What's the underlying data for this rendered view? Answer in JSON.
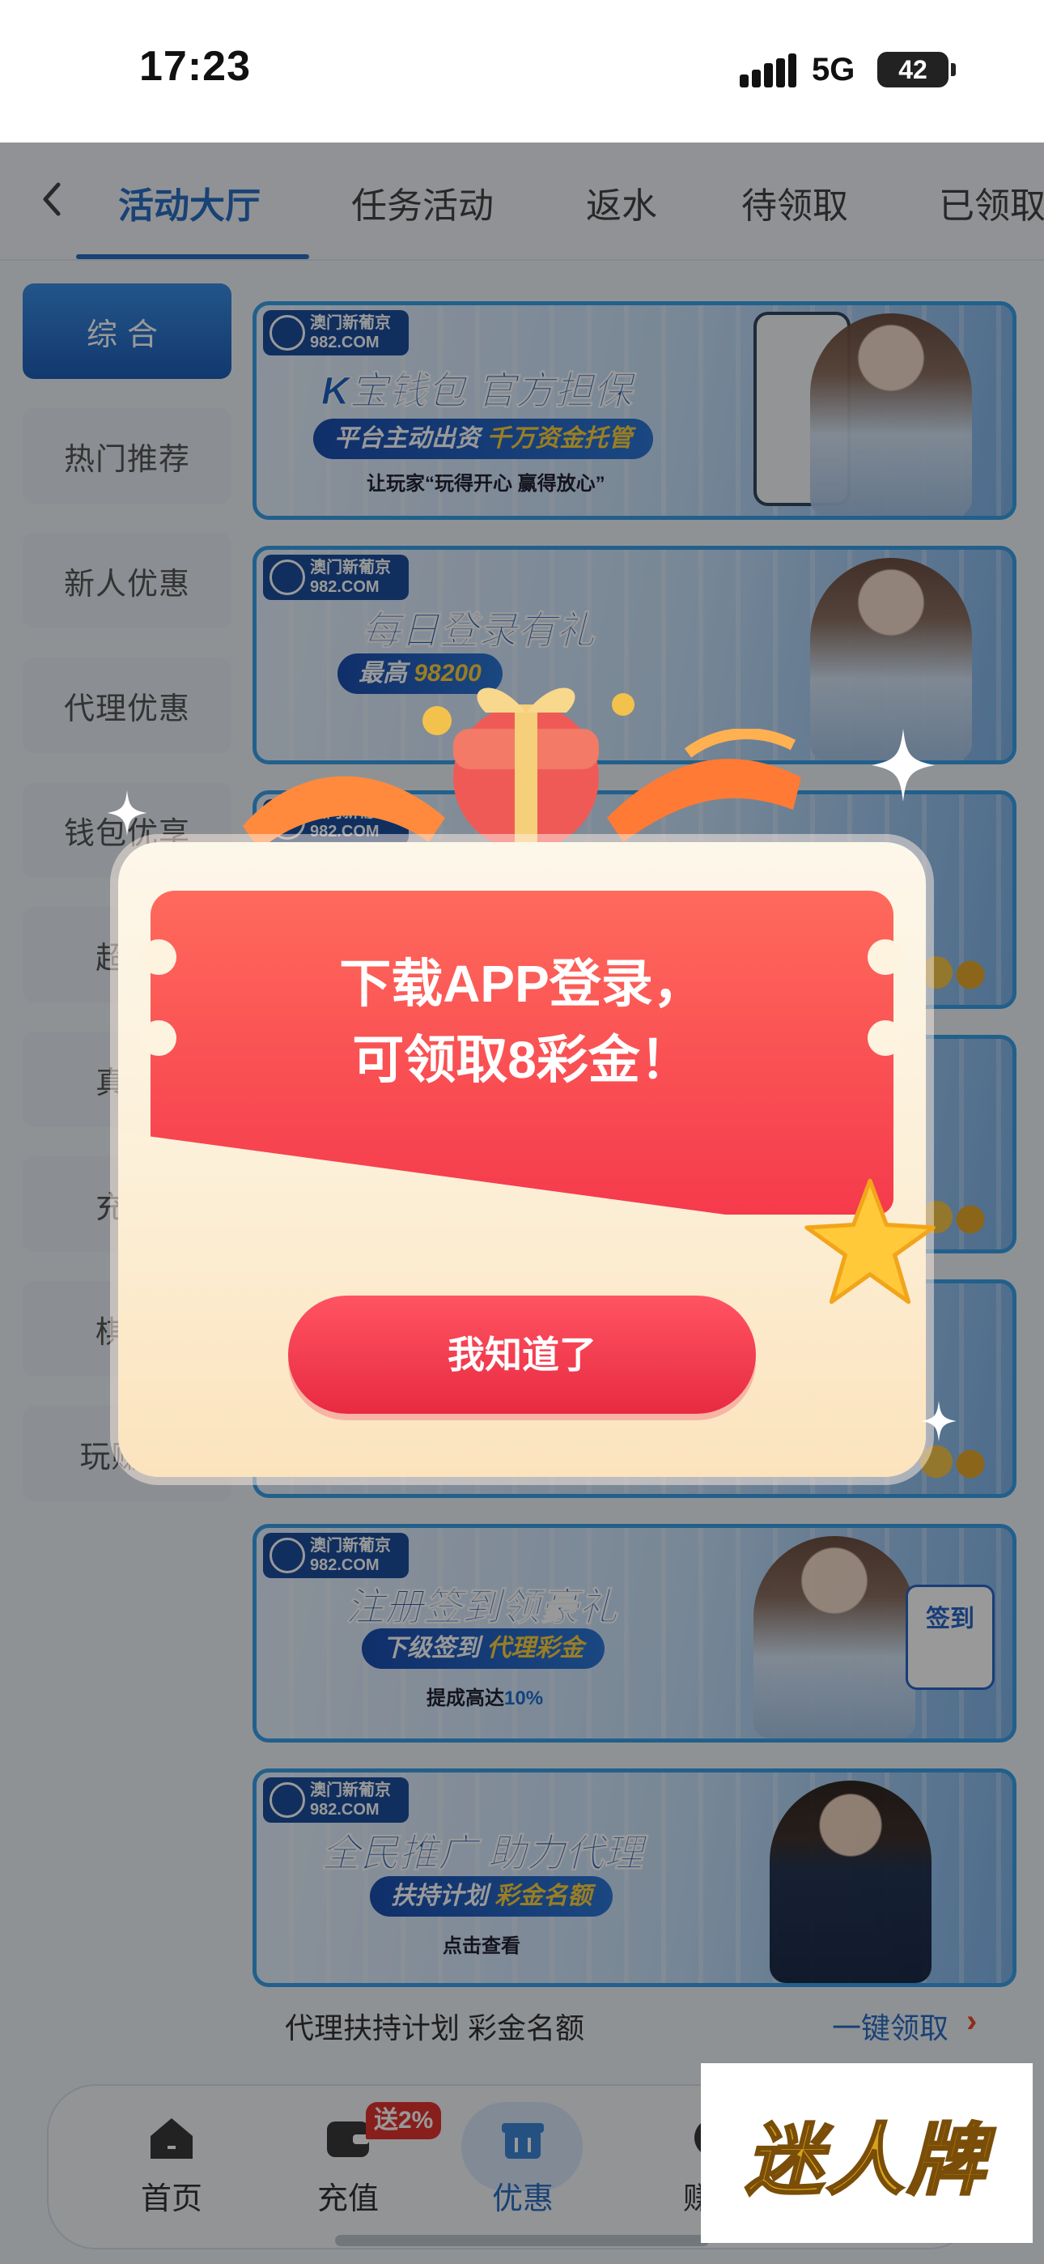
{
  "status_bar": {
    "time": "17:23",
    "network": "5G",
    "battery": "42"
  },
  "tabs": [
    {
      "label": "活动大厅",
      "active": true
    },
    {
      "label": "任务活动",
      "active": false
    },
    {
      "label": "返水",
      "active": false
    },
    {
      "label": "待领取",
      "active": false
    },
    {
      "label": "已领取",
      "active": false
    }
  ],
  "sidebar": {
    "items": [
      {
        "label": "综合",
        "active": true
      },
      {
        "label": "热门推荐"
      },
      {
        "label": "新人优惠"
      },
      {
        "label": "代理优惠"
      },
      {
        "label": "钱包优享"
      },
      {
        "label": "超级"
      },
      {
        "label": "真人"
      },
      {
        "label": "充值"
      },
      {
        "label": "棋牌"
      },
      {
        "label": "玩赚彩"
      }
    ]
  },
  "banners": [
    {
      "logo": "澳门新葡京",
      "domain": "982.COM",
      "title": "K宝钱包 官方担保",
      "sub_a": "平台主动出资 ",
      "sub_b": "千万资金托管",
      "line3_a": "让玩家“玩得开心 赢得放心”",
      "line3_b": ""
    },
    {
      "logo": "澳门新葡京",
      "domain": "982.COM",
      "title": "每日登录有礼",
      "sub_a": "最高 ",
      "sub_b": "98200",
      "line3_a": "",
      "line3_b": ""
    },
    {
      "logo": "澳门新葡京",
      "domain": "982.COM",
      "title": "",
      "sub_a": "",
      "sub_b": "",
      "line3_a": "",
      "line3_b": ""
    },
    {
      "logo": "",
      "domain": "",
      "title": "",
      "sub_a": "",
      "sub_b": "",
      "line3_a": "",
      "line3_b": ""
    },
    {
      "logo": "",
      "domain": "",
      "title": "",
      "sub_a": "",
      "sub_b": "",
      "line3_a": "",
      "line3_b": ""
    },
    {
      "logo": "澳门新葡京",
      "domain": "982.COM",
      "title": "注册签到领豪礼",
      "sub_a": "下级签到 ",
      "sub_b": "代理彩金",
      "line3_a": "提成高达",
      "line3_b": "10%",
      "stamp": "签到"
    },
    {
      "logo": "澳门新葡京",
      "domain": "982.COM",
      "title": "全民推广 助力代理",
      "sub_a": "扶持计划 ",
      "sub_b": "彩金名额",
      "line3_a": "点击查看",
      "line3_b": ""
    }
  ],
  "last_caption": "代理扶持计划 彩金名额",
  "claim_link": "一键领取",
  "claim_arrow": "›",
  "bottom_nav": [
    {
      "label": "首页",
      "icon": "home-icon"
    },
    {
      "label": "充值",
      "icon": "wallet-icon",
      "badge": "送2%"
    },
    {
      "label": "优惠",
      "icon": "gift-icon",
      "active": true
    },
    {
      "label": "赚钱",
      "icon": "coin-icon"
    }
  ],
  "popup": {
    "line1": "下载APP登录，",
    "line2": "可领取8彩金！",
    "button": "我知道了"
  },
  "watermark": "迷人牌",
  "colors": {
    "accent": "#2a6fc4",
    "popup_red": "#f53a4c",
    "gold": "#d6a21c"
  }
}
